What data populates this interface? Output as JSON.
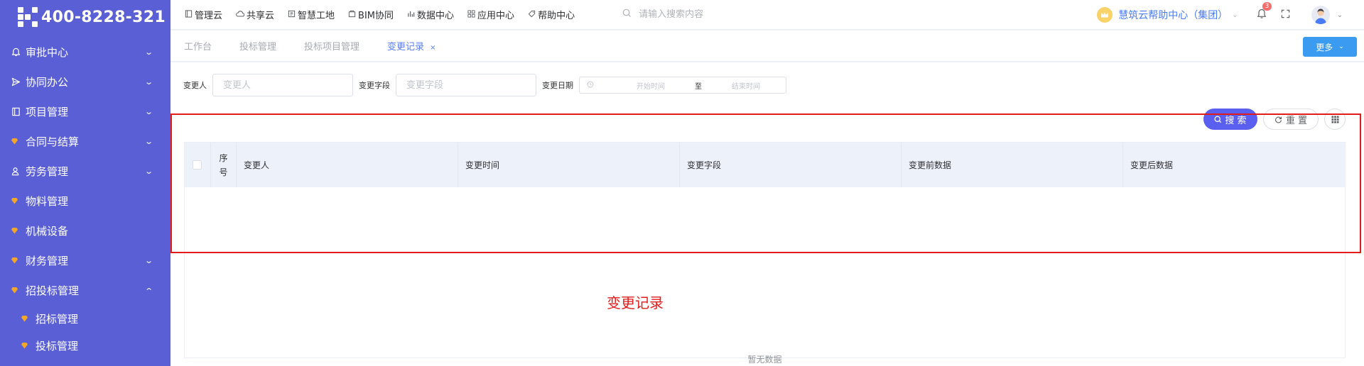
{
  "brand": {
    "phone": "400-8228-321"
  },
  "sidebar": {
    "items": [
      {
        "label": "审批中心",
        "icon": "bell-icon",
        "expanded": false
      },
      {
        "label": "协同办公",
        "icon": "send-icon",
        "expanded": false
      },
      {
        "label": "项目管理",
        "icon": "book-icon",
        "expanded": false
      },
      {
        "label": "合同与结算",
        "icon": "gem-icon",
        "expanded": false
      },
      {
        "label": "劳务管理",
        "icon": "user-icon",
        "expanded": false
      },
      {
        "label": "物料管理",
        "icon": "gem-icon"
      },
      {
        "label": "机械设备",
        "icon": "gem-icon"
      },
      {
        "label": "财务管理",
        "icon": "gem-icon",
        "expanded": false
      },
      {
        "label": "招投标管理",
        "icon": "gem-icon",
        "expanded": true
      }
    ],
    "sub_items": [
      {
        "label": "招标管理",
        "icon": "gem-icon"
      },
      {
        "label": "投标管理",
        "icon": "gem-icon"
      }
    ]
  },
  "topnav": {
    "items": [
      {
        "label": "管理云",
        "icon": "book-icon"
      },
      {
        "label": "共享云",
        "icon": "cloud-icon"
      },
      {
        "label": "智慧工地",
        "icon": "board-icon"
      },
      {
        "label": "BIM协同",
        "icon": "box-icon"
      },
      {
        "label": "数据中心",
        "icon": "bar-chart-icon"
      },
      {
        "label": "应用中心",
        "icon": "grid-icon"
      },
      {
        "label": "帮助中心",
        "icon": "tag-icon"
      }
    ],
    "search_placeholder": "请输入搜索内容",
    "org_name": "慧筑云帮助中心（集团）",
    "notifications": "3"
  },
  "tabs": {
    "items": [
      {
        "label": "工作台",
        "active": false
      },
      {
        "label": "投标管理",
        "active": false
      },
      {
        "label": "投标项目管理",
        "active": false
      },
      {
        "label": "变更记录",
        "active": true,
        "closable": true
      }
    ],
    "close_glyph": "×",
    "more_label": "更多"
  },
  "filters": {
    "changer_label": "变更人",
    "changer_placeholder": "变更人",
    "field_label": "变更字段",
    "field_placeholder": "变更字段",
    "date_label": "变更日期",
    "start_placeholder": "开始时间",
    "to_label": "至",
    "end_placeholder": "结束时间"
  },
  "actions": {
    "search_label": "搜 索",
    "reset_label": "重 置"
  },
  "table": {
    "index_header": "序号",
    "columns": [
      "变更人",
      "变更时间",
      "变更字段",
      "变更前数据",
      "变更后数据"
    ],
    "rows": [],
    "empty_text": "暂无数据"
  },
  "annotation": {
    "text": "变更记录",
    "color": "#e21b1b"
  },
  "colors": {
    "sidebar": "#5b5fd6",
    "primary": "#5b5ff0",
    "more_button": "#3b9bf1",
    "tab_active": "#5b7cf5"
  }
}
